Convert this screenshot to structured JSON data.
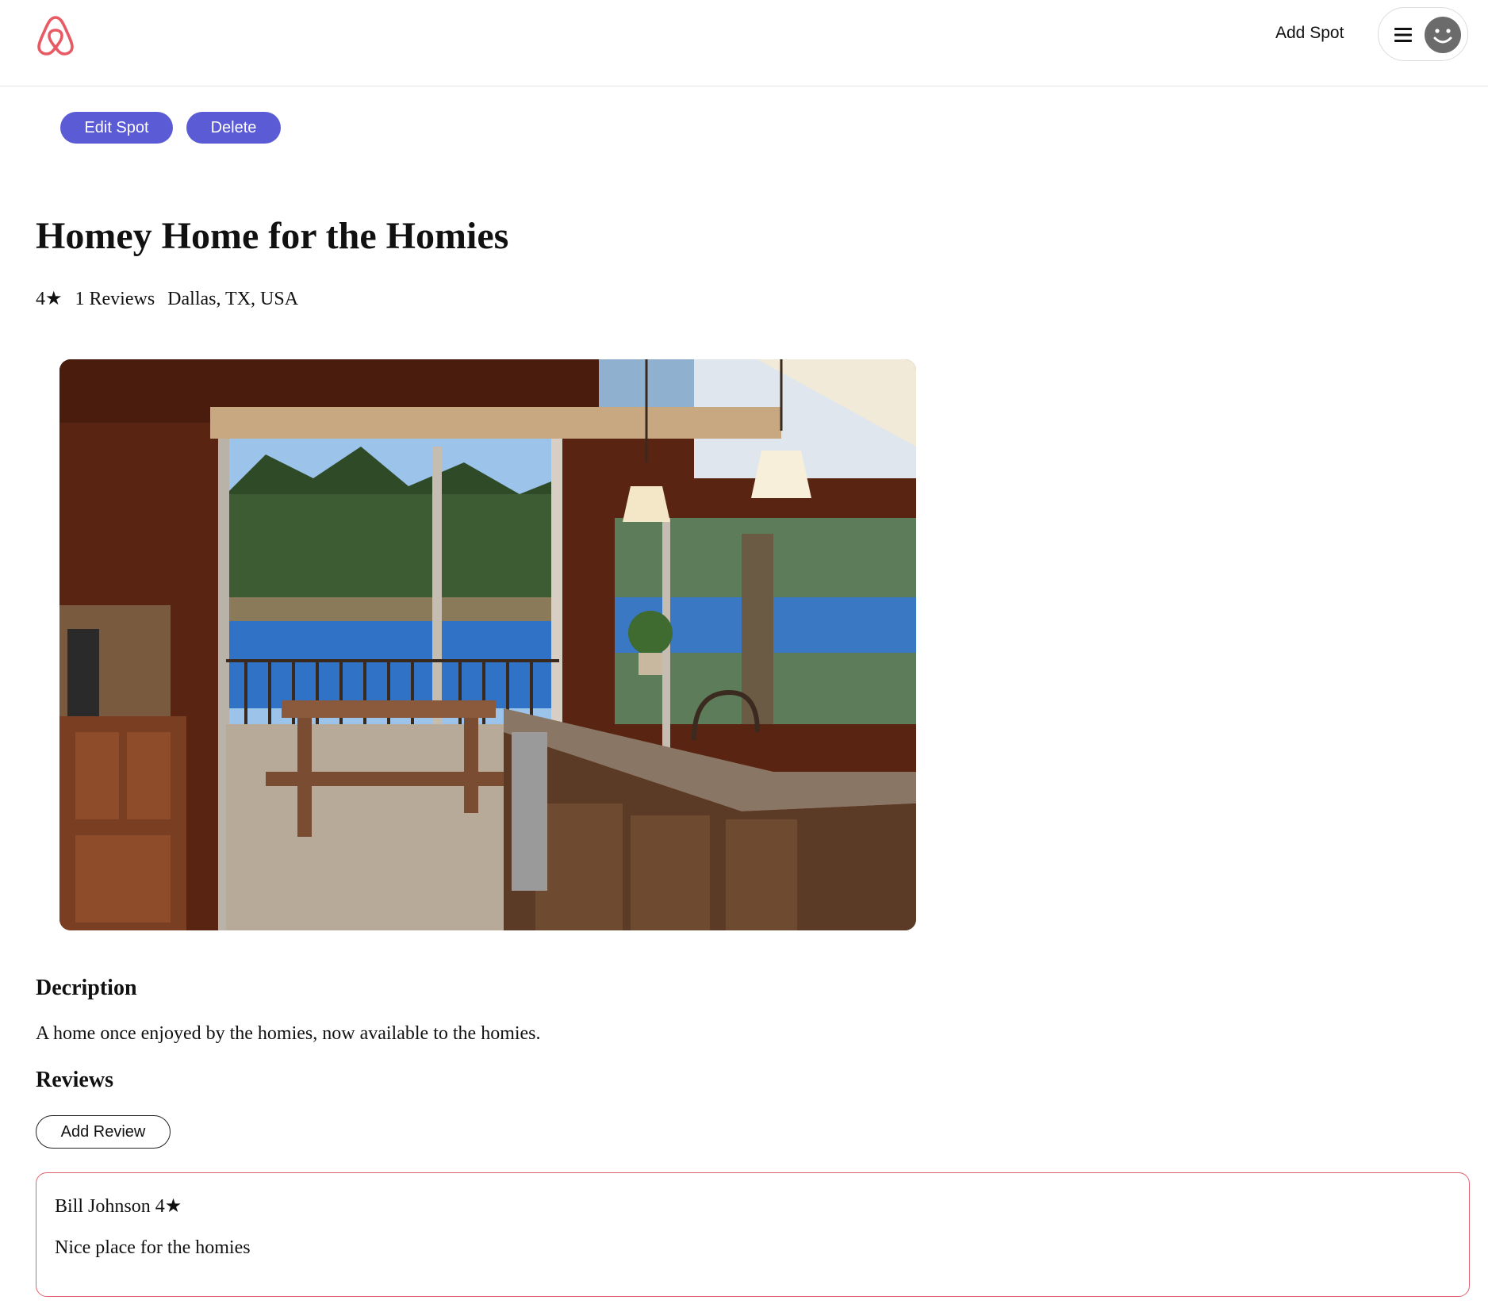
{
  "header": {
    "logo_icon": "airbnb-logo-icon",
    "brand_color": "#e85a63",
    "add_spot_label": "Add Spot",
    "menu_icon": "hamburger-menu-icon",
    "avatar_icon": "smiley-avatar-icon"
  },
  "owner_actions": {
    "edit_label": "Edit Spot",
    "delete_label": "Delete",
    "button_color": "#5b5bd6"
  },
  "spot": {
    "title": "Homey Home for the Homies",
    "rating": "4★",
    "review_count": "1 Reviews",
    "location": "Dallas, TX, USA",
    "image_icon": "kitchen-lake-view-photo"
  },
  "description": {
    "heading": "Decription",
    "text": "A home once enjoyed by the homies, now available to the homies."
  },
  "reviews": {
    "heading": "Reviews",
    "add_label": "Add Review",
    "card_border_color": "#e0626f",
    "items": [
      {
        "author": "Bill Johnson 4★",
        "text": "Nice place for the homies"
      }
    ]
  }
}
